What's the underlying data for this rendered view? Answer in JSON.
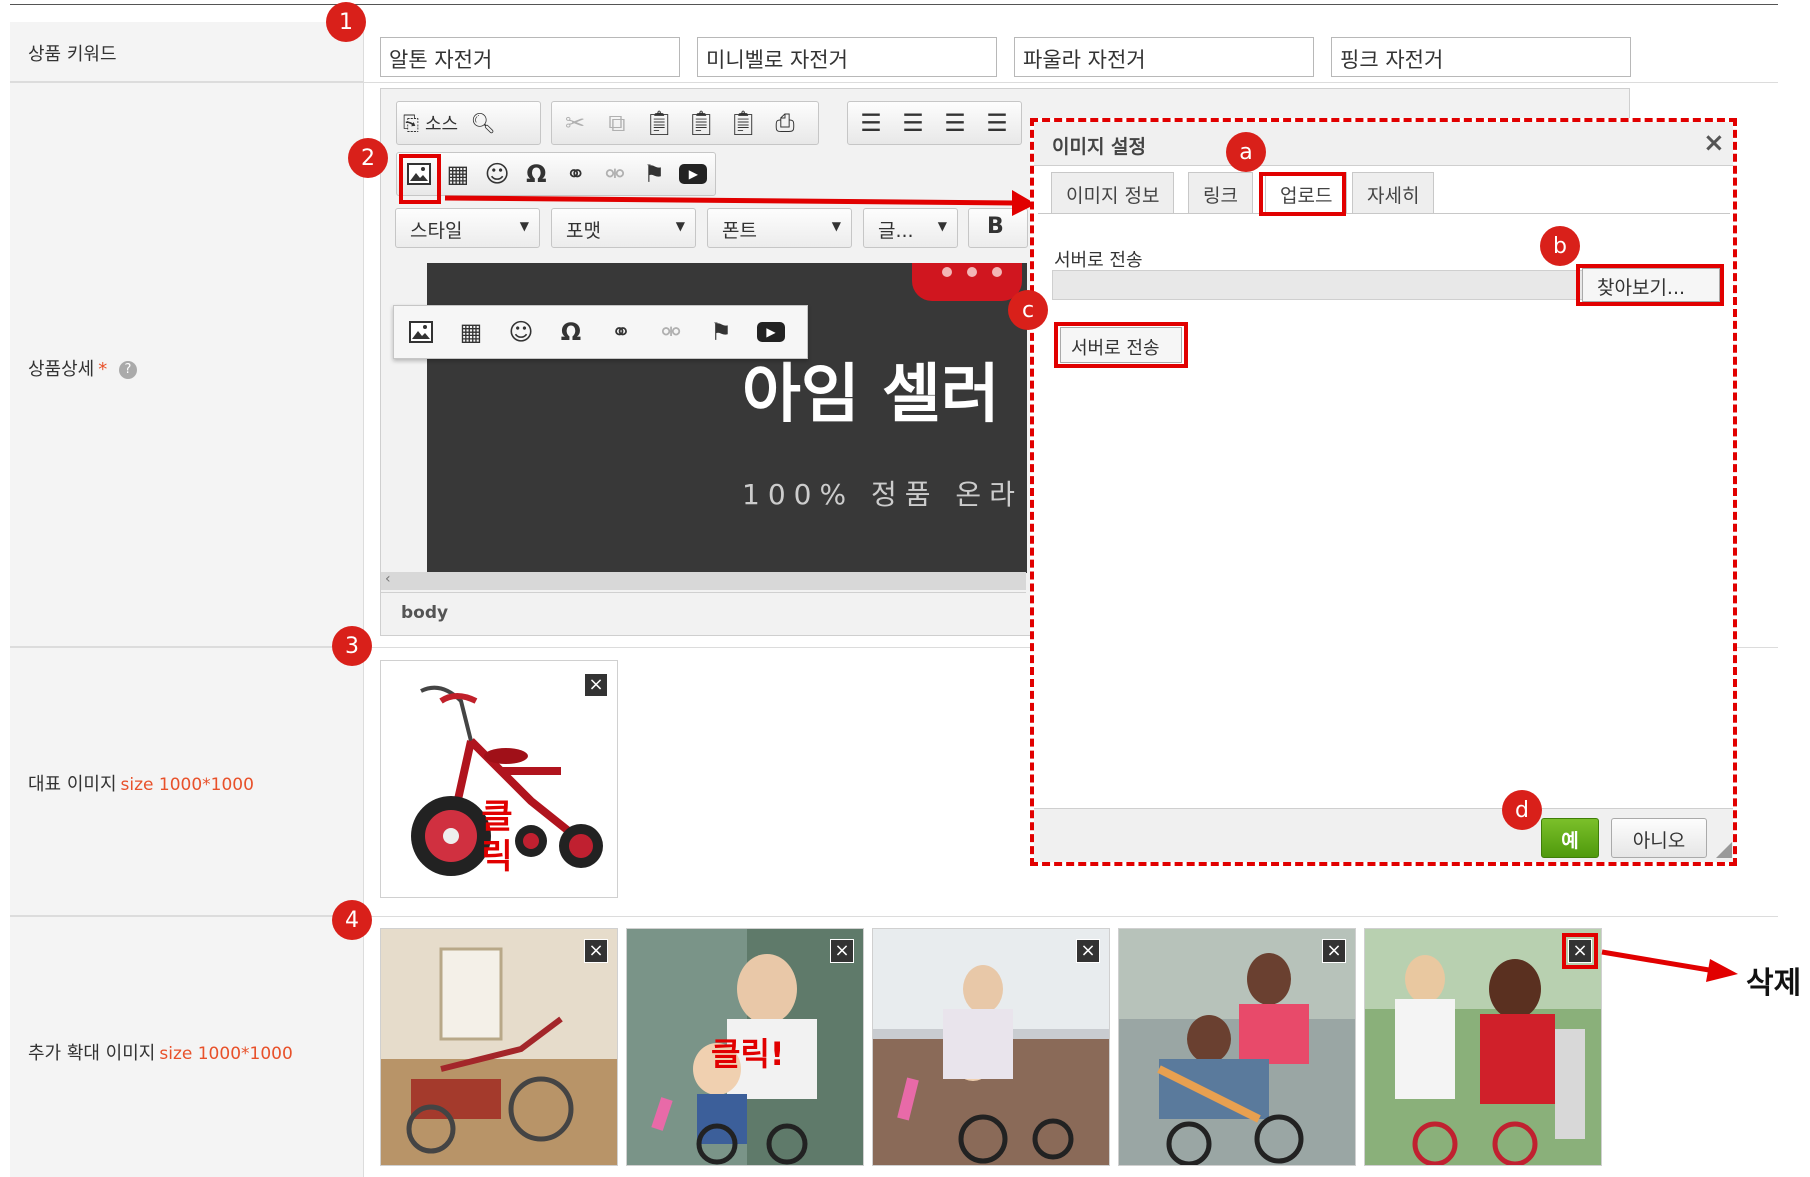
{
  "form": {
    "keyword_label": "상품 키워드",
    "detail_label": "상품상세",
    "detail_required_mark": "*",
    "main_image_label": "대표 이미지",
    "main_image_size": "size 1000*1000",
    "extra_image_label": "추가 확대 이미지",
    "extra_image_size": "size 1000*1000"
  },
  "keywords": [
    "알톤 자전거",
    "미니벨로 자전거",
    "파울라 자전거",
    "핑크 자전거"
  ],
  "editor": {
    "source_label": "소스",
    "style_combo": "스타일",
    "format_combo": "포맷",
    "font_combo": "폰트",
    "size_combo": "글...",
    "bold_label": "B",
    "canvas_title": "아임 셀러",
    "canvas_subtitle": "100% 정품 온라",
    "status_path": "body",
    "image_icon": "image-icon",
    "table_icon": "table-icon",
    "smiley_icon": "smiley-icon",
    "omega_icon": "omega-icon",
    "link_icon": "link-icon",
    "unlink_icon": "unlink-icon",
    "flag_icon": "flag-icon",
    "youtube_icon": "youtube-icon"
  },
  "dialog": {
    "title": "이미지 설정",
    "close": "×",
    "tabs": [
      "이미지 정보",
      "링크",
      "업로드",
      "자세히"
    ],
    "active_tab": "업로드",
    "upload_label": "서버로 전송",
    "browse_button": "찾아보기...",
    "send_button": "서버로 전송",
    "ok_button": "예",
    "cancel_button": "아니오"
  },
  "badges": {
    "n1": "1",
    "n2": "2",
    "n3": "3",
    "n4": "4",
    "a": "a",
    "b": "b",
    "c": "c",
    "d": "d"
  },
  "annotations": {
    "click_main": "클\n릭",
    "click_extra": "클릭!",
    "delete": "삭제"
  },
  "colors": {
    "annotation_red": "#e10000",
    "badge_red": "#d9201a",
    "ok_green": "#5ea815"
  }
}
